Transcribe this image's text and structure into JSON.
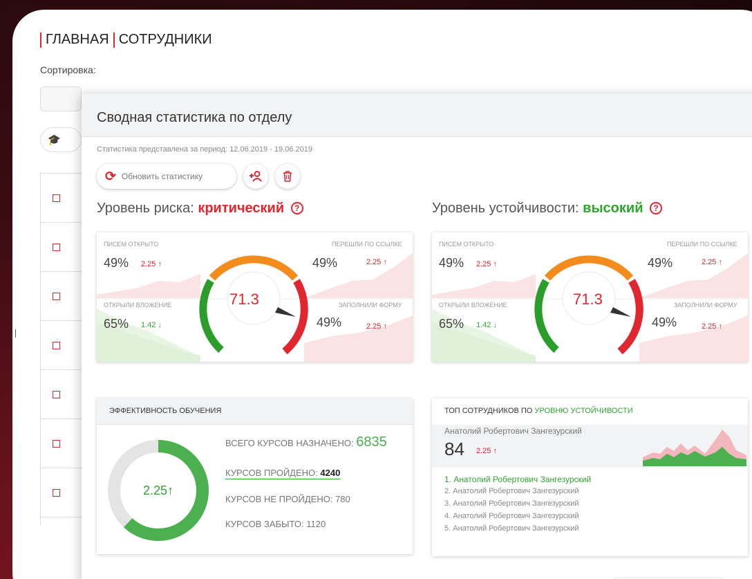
{
  "header": {
    "breadcrumb": [
      "ГЛАВНАЯ",
      "СОТРУДНИКИ"
    ],
    "sort_label": "Сортировка:"
  },
  "modal": {
    "title": "Сводная статистика по отделу",
    "close_icon": "close-icon",
    "period_text": "Статистика представлена за период: 12.06.2019 - 19.06.2019",
    "refresh_label": "Обновить статистику",
    "add_user_icon": "add-user-icon",
    "delete_icon": "trash-icon"
  },
  "risk": {
    "label": "Уровень риска:",
    "value": "критический",
    "gauge_value": "71.3",
    "stats": {
      "opened_label": "ПИСЕМ ОТКРЫТО",
      "opened_value": "49%",
      "opened_delta": "2.25 ↑",
      "link_label": "ПЕРЕШЛИ ПО ССЫЛКЕ",
      "link_value": "49%",
      "link_delta": "2.25 ↑",
      "attach_label": "ОТКРЫЛИ ВЛОЖЕНИЕ",
      "attach_value": "65%",
      "attach_delta": "1.42 ↓",
      "form_label": "ЗАПОЛНИЛИ ФОРМУ",
      "form_value": "49%",
      "form_delta": "2.25 ↑"
    }
  },
  "stability": {
    "label": "Уровень устойчивости:",
    "value": "высокий",
    "gauge_value": "71.3",
    "stats": {
      "opened_label": "ПИСЕМ ОТКРЫТО",
      "opened_value": "49%",
      "opened_delta": "2.25 ↑",
      "link_label": "ПЕРЕШЛИ ПО ССЫЛКЕ",
      "link_value": "49%",
      "link_delta": "2.25 ↑",
      "attach_label": "ОТКРЫЛИ ВЛОЖЕНИЕ",
      "attach_value": "65%",
      "attach_delta": "1.42 ↓",
      "form_label": "ЗАПОЛНИЛИ ФОРМУ",
      "form_value": "49%",
      "form_delta": "2.25 ↑"
    }
  },
  "training": {
    "title": "ЭФФЕКТИВНОСТЬ ОБУЧЕНИЯ",
    "donut_value": "2.25↑",
    "donut_completed_fraction": 0.62,
    "total_label": "ВСЕГО КУРСОВ НАЗНАЧЕНО:",
    "total_value": "6835",
    "passed_label": "КУРСОВ ПРОЙДЕНО:",
    "passed_value": "4240",
    "failed_label": "КУРСОВ НЕ ПРОЙДЕНО:",
    "failed_value": "780",
    "forgot_label": "КУРСОВ ЗАБЫТО:",
    "forgot_value": "1120"
  },
  "top": {
    "title_prefix": "ТОП СОТРУДНИКОВ ПО",
    "title_highlight": "УРОВНЮ УСТОЙЧИВОСТИ",
    "leader_name": "Анатолий Робертович Зангезурский",
    "leader_score": "84",
    "leader_delta": "2.25 ↑",
    "list": [
      "1. Анатолий Робертович Зангезурский",
      "2. Анатолий Робертович Зангезурский",
      "3. Анатолий Робертович Зангезурский",
      "4. Анатолий Робертович Зангезурский",
      "5. Анатолий Робертович Зангезурский"
    ]
  },
  "colors": {
    "accent": "#e0262f",
    "green": "#2fa52f",
    "orange": "#f28c1c"
  }
}
